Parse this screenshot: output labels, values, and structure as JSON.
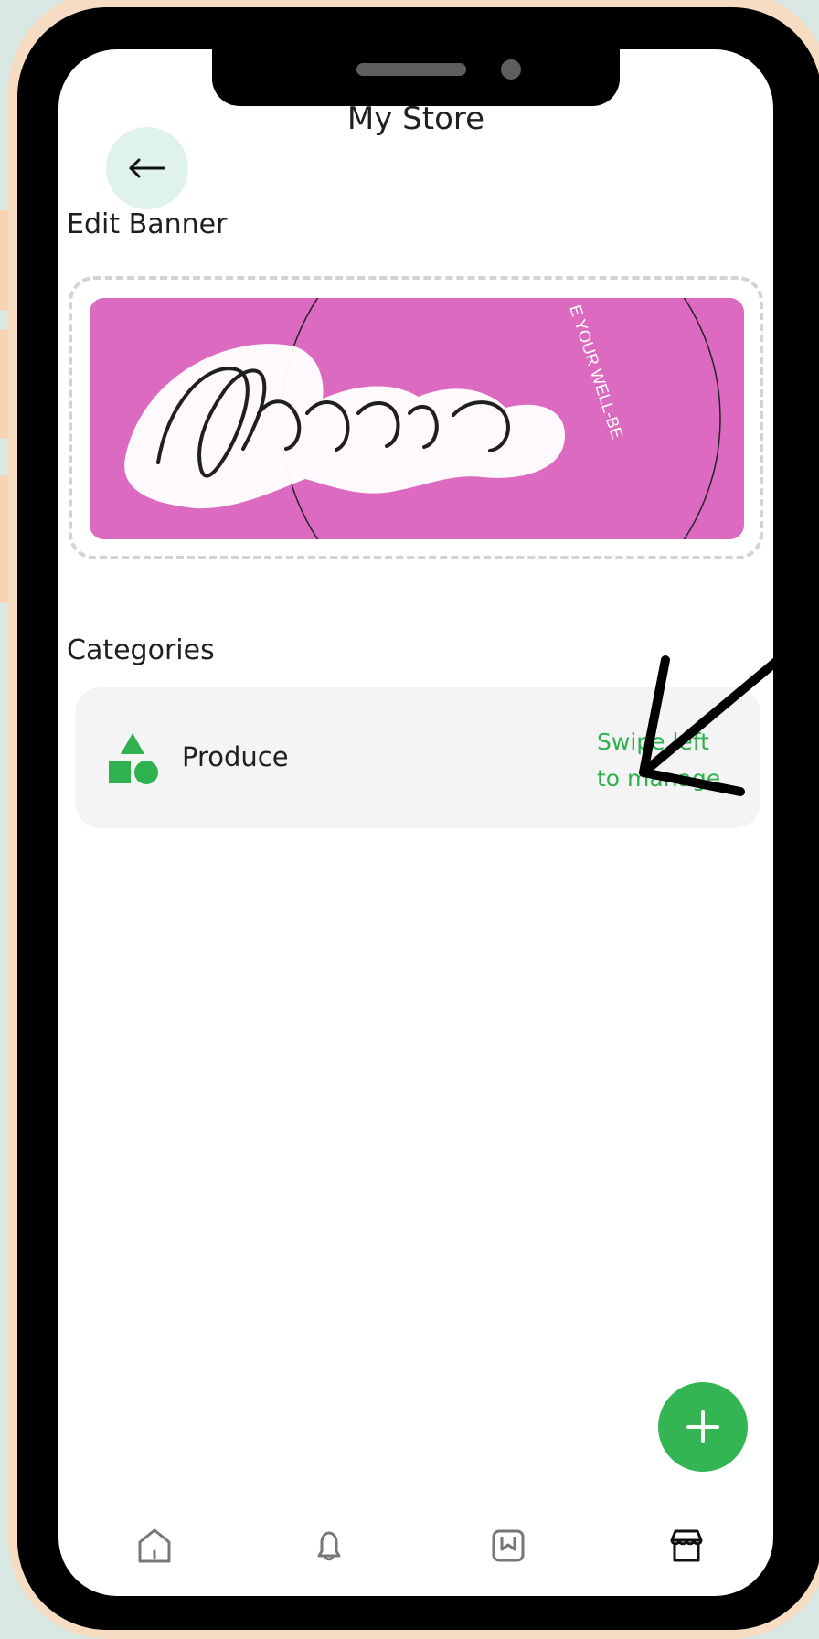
{
  "page_title": "My Store",
  "edit_banner_label": "Edit Banner",
  "banner": {
    "brand_text": "Winnie",
    "circle_text": "E YOUR WELL-BE",
    "background_color": "#dc6ac1"
  },
  "categories_label": "Categories",
  "category": {
    "name": "Produce",
    "swipe_hint_line1": "Swipe left",
    "swipe_hint_line2": "to manage",
    "accent_color": "#2fb14f"
  },
  "fab": {
    "icon": "plus-icon",
    "color": "#33b553"
  },
  "bottom_nav": [
    {
      "name": "home",
      "icon": "home-icon",
      "active": false
    },
    {
      "name": "notifications",
      "icon": "bell-icon",
      "active": false
    },
    {
      "name": "bookmarks",
      "icon": "bookmark-icon",
      "active": false
    },
    {
      "name": "store",
      "icon": "store-icon",
      "active": true
    }
  ]
}
